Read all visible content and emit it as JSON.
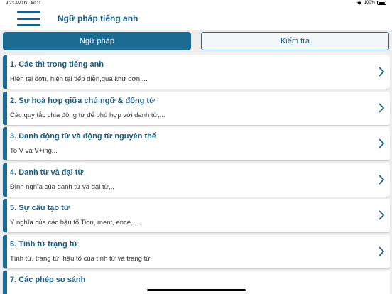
{
  "status": {
    "time": "9:23 AM",
    "date": "Thu Jul 11",
    "battery": "100%"
  },
  "header": {
    "title": "Ngữ pháp tiếng anh"
  },
  "tabs": [
    {
      "label": "Ngữ pháp",
      "active": true
    },
    {
      "label": "Kiểm tra",
      "active": false
    }
  ],
  "colors": {
    "accent": "#1c6b93",
    "title": "#1c5e84"
  },
  "items": [
    {
      "title": "1. Các thì trong tiếng anh",
      "subtitle": "Hiện tại đơn, hiện tại tiếp diễn,quá khứ đơn,..."
    },
    {
      "title": "2. Sự hoà hợp giữa chủ ngữ & động từ",
      "subtitle": "Các quy tắc chia động từ để phù hợp với danh từ,..."
    },
    {
      "title": "3. Danh động từ và động từ nguyên thể",
      "subtitle": "To V và V+ing,.."
    },
    {
      "title": "4. Danh từ và đại từ",
      "subtitle": "Định nghĩa của danh từ và đại từ,.."
    },
    {
      "title": "5. Sự cấu tạo từ",
      "subtitle": "Ý nghĩa của các hậu tố Tion, ment, ence, ..."
    },
    {
      "title": "6. Tính từ trạng từ",
      "subtitle": "Tính từ, trạng từ, hậu tố của tính từ và trạng từ"
    },
    {
      "title": "7. Các phép so sánh",
      "subtitle": ""
    }
  ]
}
